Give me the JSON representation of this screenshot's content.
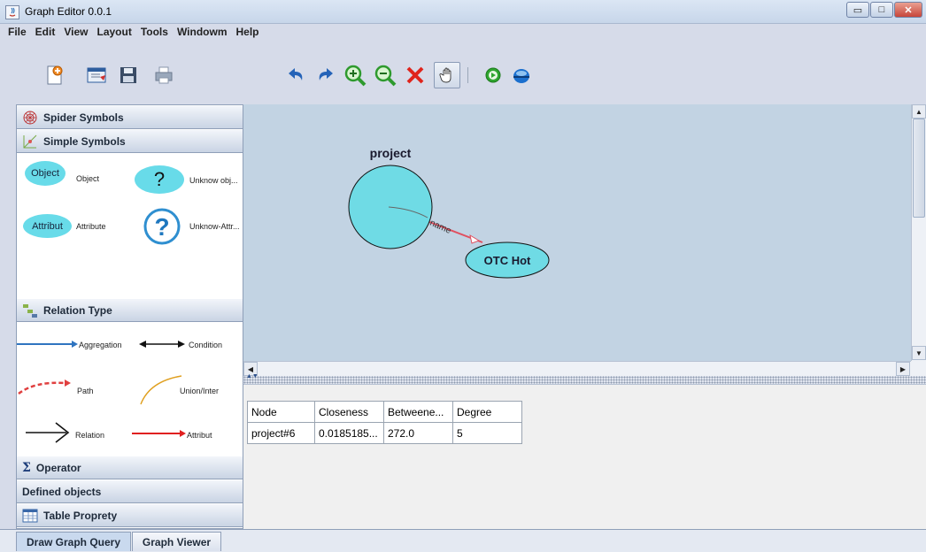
{
  "window": {
    "title": "Graph Editor 0.0.1",
    "minimize": "▭",
    "maximize": "□",
    "close": "✕"
  },
  "menu": [
    "File",
    "Edit",
    "View",
    "Layout",
    "Tools",
    "Windowm",
    "Help"
  ],
  "toolbar": {
    "buttons": [
      "new-document-icon",
      "import-icon",
      "save-icon",
      "print-icon",
      "undo-icon",
      "redo-icon",
      "zoom-in-icon",
      "zoom-out-icon",
      "delete-icon",
      "pan-hand-icon",
      "run-icon",
      "globe-icon"
    ],
    "active": "pan-hand-icon"
  },
  "palette": {
    "sections": {
      "spider_symbols": "Spider Symbols",
      "simple_symbols": "Simple Symbols",
      "relation_type": "Relation Type",
      "operator": "Operator",
      "defined_objects": "Defined objects",
      "table_property": "Table Proprety"
    },
    "symbols": {
      "object_shape": "Object",
      "object_label": "Object",
      "unknown_object_label": "Unknow obj...",
      "attribute_shape": "Attribut",
      "attribute_label": "Attribute",
      "unknown_attr_label": "Unknow-Attr..."
    },
    "relations": {
      "aggregation": "Aggregation",
      "condition": "Condition",
      "path": "Path",
      "union": "Union/Inter",
      "relation": "Relation",
      "attribut": "Attribut"
    }
  },
  "graph": {
    "nodes": {
      "project_label": "project",
      "otc_label": "OTC Hot"
    },
    "edge_label": "name",
    "colors": {
      "canvas": "#c2d3e3",
      "node_fill": "#6fdbe5",
      "edge": "#e05060"
    }
  },
  "table": {
    "headers": [
      "Node",
      "Closeness",
      "Betweene...",
      "Degree"
    ],
    "rows": [
      [
        "project#6",
        "0.0185185...",
        "272.0",
        "5"
      ]
    ]
  },
  "tabs": {
    "draw_graph_query": "Draw Graph Query",
    "graph_viewer": "Graph Viewer"
  }
}
